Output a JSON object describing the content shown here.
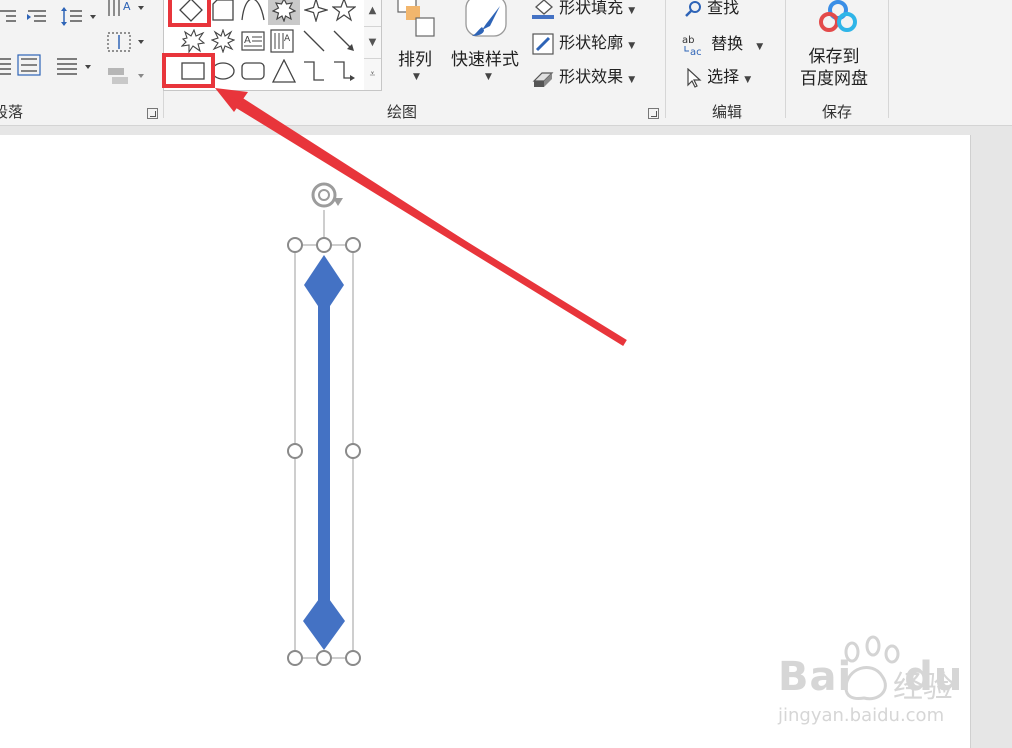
{
  "ribbon": {
    "paragraph_group_label": "段落",
    "drawing_group_label": "绘图",
    "editing_group_label": "编辑",
    "save_group_label": "保存",
    "arrange_label": "排列",
    "quick_styles_label": "快速样式",
    "shape_fill_label": "形状填充",
    "shape_outline_label": "形状轮廓",
    "shape_effects_label": "形状效果",
    "find_label": "查找",
    "replace_label": "替换",
    "select_label": "选择",
    "save_to_line1": "保存到",
    "save_to_line2": "百度网盘"
  },
  "shape_gallery": {
    "row1": [
      "diamond-shape",
      "flowchart-shape",
      "arc-shape",
      "seven-point-star-shape",
      "four-point-star-shape",
      "five-point-star-shape"
    ],
    "row2": [
      "explosion-1-shape",
      "explosion-2-shape",
      "text-box-shape",
      "vertical-text-box-shape",
      "line-shape",
      "arrow-line-shape"
    ],
    "row3": [
      "rectangle-shape",
      "oval-shape",
      "rounded-rectangle-shape",
      "triangle-shape",
      "elbow-connector-shape",
      "elbow-arrow-connector-shape"
    ]
  },
  "colors": {
    "accent_shape": "#4472c4",
    "highlight": "#e8353b",
    "ribbon_bg": "#f3f3f3",
    "canvas_bg": "#ffffff"
  },
  "watermark": {
    "brand": "Bai",
    "brand2": "du",
    "chinese": "经验",
    "url": "jingyan.baidu.com"
  }
}
